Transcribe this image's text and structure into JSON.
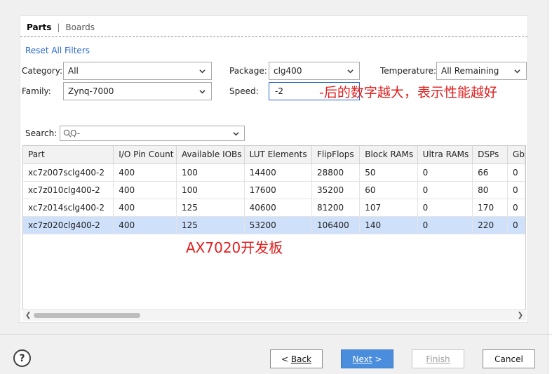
{
  "tabs": {
    "parts": "Parts",
    "separator": "|",
    "boards": "Boards"
  },
  "reset_link": "Reset All Filters",
  "filters": {
    "category": {
      "label": "Category:",
      "value": "All"
    },
    "package": {
      "label": "Package:",
      "value": "clg400"
    },
    "temperature": {
      "label": "Temperature:",
      "value": "All Remaining"
    },
    "family": {
      "label": "Family:",
      "value": "Zynq-7000"
    },
    "speed": {
      "label": "Speed:",
      "value": "-2"
    }
  },
  "annotations": {
    "speed_note": "-后的数字越大，表示性能越好",
    "board_note": "AX7020开发板",
    "color": "#e02020"
  },
  "search": {
    "label": "Search:",
    "placeholder": "Q-"
  },
  "table": {
    "columns": [
      "Part",
      "I/O Pin Count",
      "Available IOBs",
      "LUT Elements",
      "FlipFlops",
      "Block RAMs",
      "Ultra RAMs",
      "DSPs",
      "Gb"
    ],
    "rows": [
      [
        "xc7z007sclg400-2",
        "400",
        "100",
        "14400",
        "28800",
        "50",
        "0",
        "66",
        "0"
      ],
      [
        "xc7z010clg400-2",
        "400",
        "100",
        "17600",
        "35200",
        "60",
        "0",
        "80",
        "0"
      ],
      [
        "xc7z014sclg400-2",
        "400",
        "125",
        "40600",
        "81200",
        "107",
        "0",
        "170",
        "0"
      ],
      [
        "xc7z020clg400-2",
        "400",
        "125",
        "53200",
        "106400",
        "140",
        "0",
        "220",
        "0"
      ]
    ],
    "selected_row": 3
  },
  "buttons": {
    "help": "?",
    "back_prefix": "< ",
    "back": "Back",
    "next": "Next",
    "next_suffix": " >",
    "finish": "Finish",
    "cancel": "Cancel"
  },
  "colors": {
    "accent": "#4a8ddc",
    "selected_row": "#cfe0fb",
    "link": "#2a6acf"
  }
}
